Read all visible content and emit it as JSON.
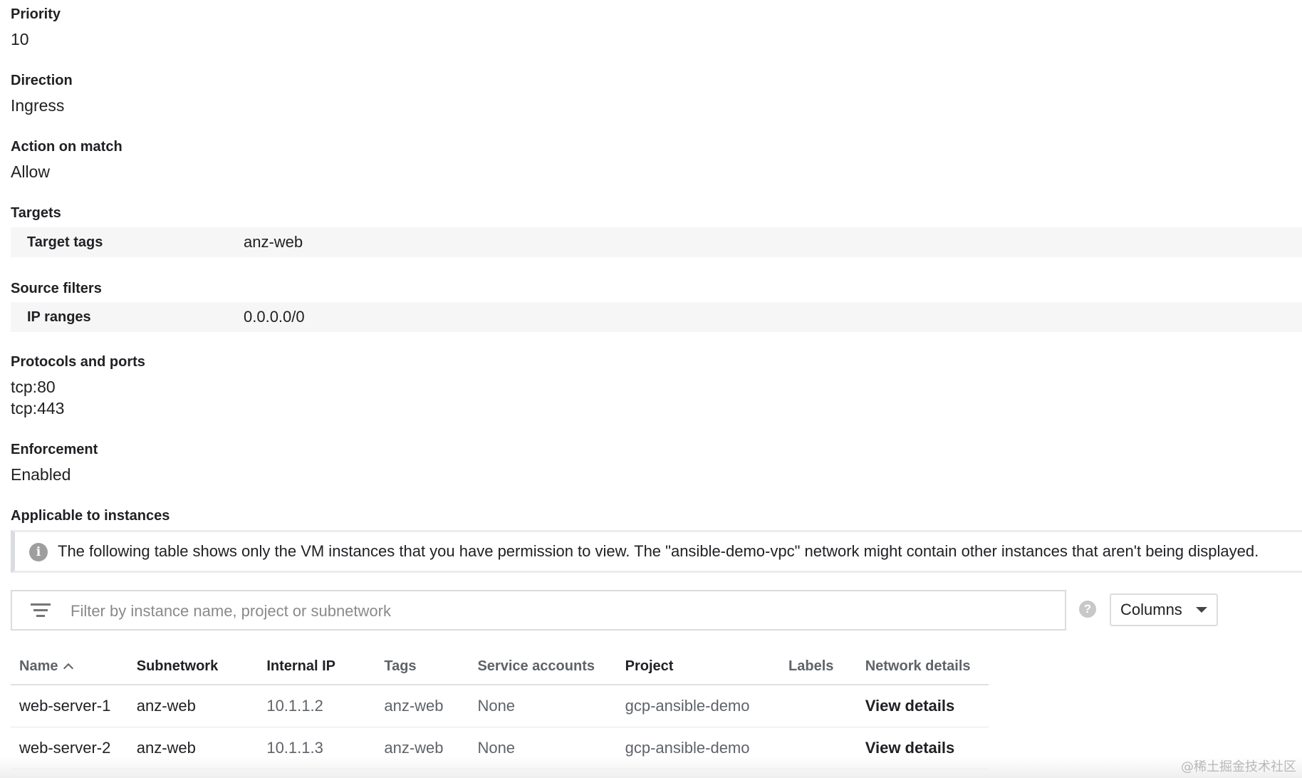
{
  "details": {
    "priority": {
      "label": "Priority",
      "value": "10"
    },
    "direction": {
      "label": "Direction",
      "value": "Ingress"
    },
    "action": {
      "label": "Action on match",
      "value": "Allow"
    },
    "targets": {
      "label": "Targets",
      "key": "Target tags",
      "value": "anz-web"
    },
    "source_filters": {
      "label": "Source filters",
      "key": "IP ranges",
      "value": "0.0.0.0/0"
    },
    "protocols": {
      "label": "Protocols and ports",
      "values": [
        "tcp:80",
        "tcp:443"
      ]
    },
    "enforcement": {
      "label": "Enforcement",
      "value": "Enabled"
    },
    "applicable": {
      "label": "Applicable to instances"
    }
  },
  "notice": {
    "icon": "info-icon",
    "text": "The following table shows only the VM instances that you have permission to view. The \"ansible-demo-vpc\" network might contain other instances that aren't being displayed."
  },
  "filter": {
    "icon": "filter-icon",
    "placeholder": "Filter by instance name, project or subnetwork",
    "value": ""
  },
  "toolbar": {
    "help_icon": "help-icon",
    "help_glyph": "?",
    "columns_label": "Columns",
    "columns_icon": "caret-down-icon"
  },
  "table": {
    "sort_icon": "sort-ascending-icon",
    "headers": [
      "Name",
      "Subnetwork",
      "Internal IP",
      "Tags",
      "Service accounts",
      "Project",
      "Labels",
      "Network details"
    ],
    "rows": [
      {
        "name": "web-server-1",
        "subnetwork": "anz-web",
        "internal_ip": "10.1.1.2",
        "tags": "anz-web",
        "service_accounts": "None",
        "project": "gcp-ansible-demo",
        "labels": "",
        "network_details": "View details"
      },
      {
        "name": "web-server-2",
        "subnetwork": "anz-web",
        "internal_ip": "10.1.1.3",
        "tags": "anz-web",
        "service_accounts": "None",
        "project": "gcp-ansible-demo",
        "labels": "",
        "network_details": "View details"
      }
    ]
  },
  "watermark": "@稀土掘金技术社区",
  "colors": {
    "text": "#202124",
    "muted_text": "#5f6368",
    "row_background": "#f6f6f6",
    "border": "#dadce0",
    "icon_gray": "#9e9e9e"
  }
}
